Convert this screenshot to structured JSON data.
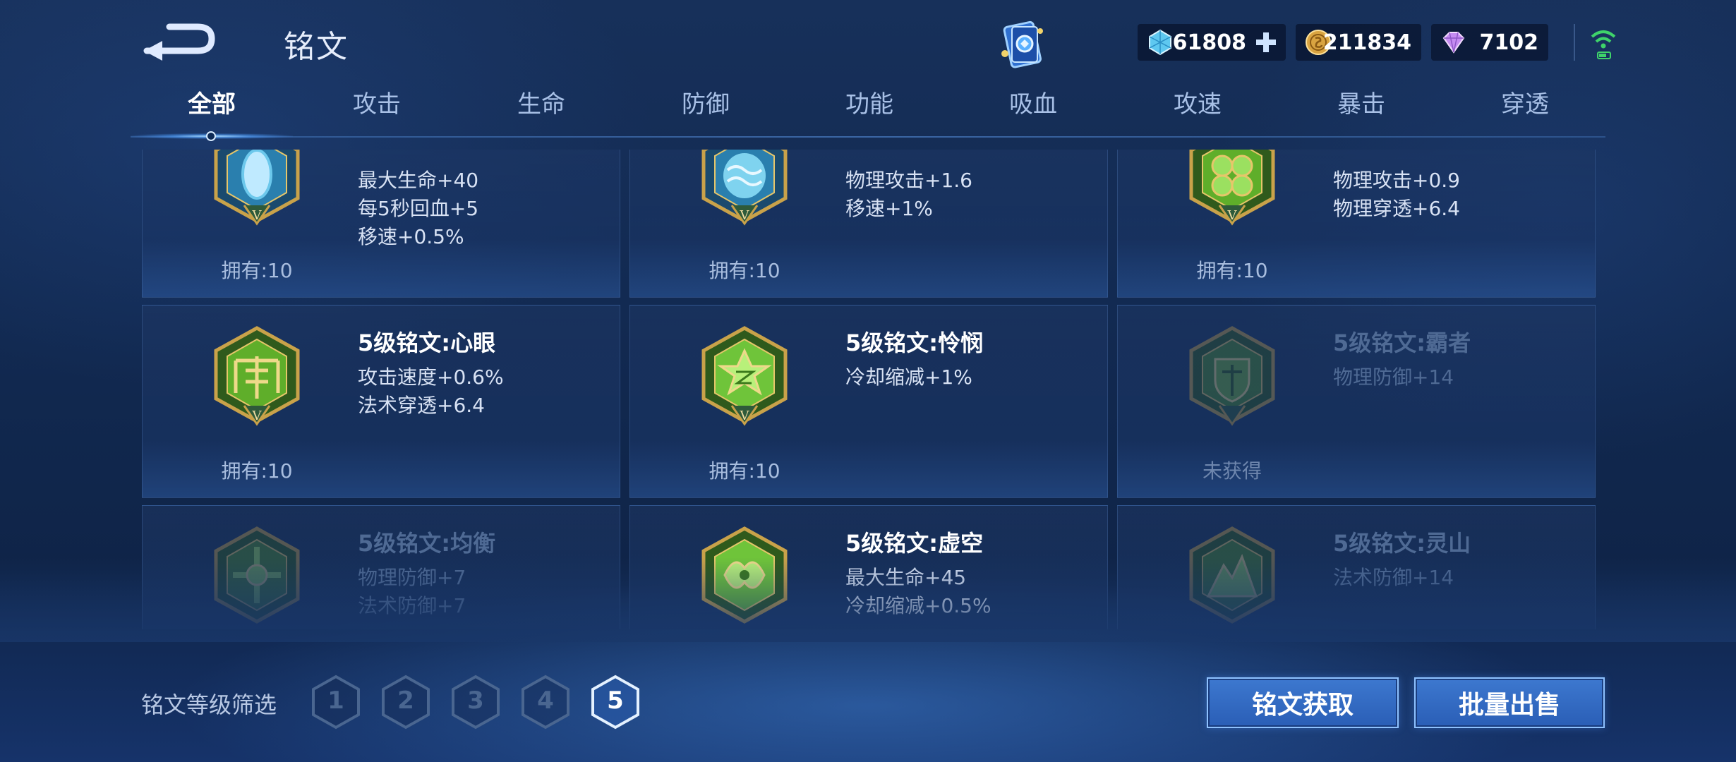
{
  "header": {
    "title": "铭文",
    "currencies": {
      "diamond": "61808",
      "gold": "211834",
      "gem": "7102"
    }
  },
  "tabs": [
    {
      "label": "全部",
      "active": true
    },
    {
      "label": "攻击",
      "active": false
    },
    {
      "label": "生命",
      "active": false
    },
    {
      "label": "防御",
      "active": false
    },
    {
      "label": "功能",
      "active": false
    },
    {
      "label": "吸血",
      "active": false
    },
    {
      "label": "攻速",
      "active": false
    },
    {
      "label": "暴击",
      "active": false
    },
    {
      "label": "穿透",
      "active": false
    }
  ],
  "cards": [
    {
      "name": "",
      "attrs": [
        "最大生命+40",
        "每5秒回血+5",
        "移速+0.5%"
      ],
      "own": "拥有:10",
      "state": "owned",
      "emblem": "blue-drop-emblem"
    },
    {
      "name": "",
      "attrs": [
        "物理攻击+1.6",
        "移速+1%"
      ],
      "own": "拥有:10",
      "state": "owned",
      "emblem": "blue-wave-emblem"
    },
    {
      "name": "",
      "attrs": [
        "物理攻击+0.9",
        "物理穿透+6.4"
      ],
      "own": "拥有:10",
      "state": "owned",
      "emblem": "green-clover-emblem"
    },
    {
      "name": "5级铭文:心眼",
      "attrs": [
        "攻击速度+0.6%",
        "法术穿透+6.4"
      ],
      "own": "拥有:10",
      "state": "owned",
      "emblem": "green-crest-emblem"
    },
    {
      "name": "5级铭文:怜悯",
      "attrs": [
        "冷却缩减+1%"
      ],
      "own": "拥有:10",
      "state": "owned",
      "emblem": "green-star-emblem"
    },
    {
      "name": "5级铭文:霸者",
      "attrs": [
        "物理防御+14"
      ],
      "own": "未获得",
      "state": "locked",
      "emblem": "green-shield-emblem"
    },
    {
      "name": "5级铭文:均衡",
      "attrs": [
        "物理防御+7",
        "法术防御+7"
      ],
      "own": "",
      "state": "locked",
      "emblem": "green-cross-emblem"
    },
    {
      "name": "5级铭文:虚空",
      "attrs": [
        "最大生命+45",
        "冷却缩减+0.5%"
      ],
      "own": "",
      "state": "owned",
      "emblem": "green-void-emblem"
    },
    {
      "name": "5级铭文:灵山",
      "attrs": [
        "法术防御+14"
      ],
      "own": "",
      "state": "locked",
      "emblem": "green-mountain-emblem"
    }
  ],
  "footer": {
    "filter_label": "铭文等级筛选",
    "levels": [
      "1",
      "2",
      "3",
      "4",
      "5"
    ],
    "selected_level": "5",
    "btn_obtain": "铭文获取",
    "btn_sell": "批量出售"
  },
  "colors": {
    "accent": "#3d78cf",
    "owned_emblem": "#6fcf3a",
    "blue_emblem": "#6cc8ec"
  }
}
